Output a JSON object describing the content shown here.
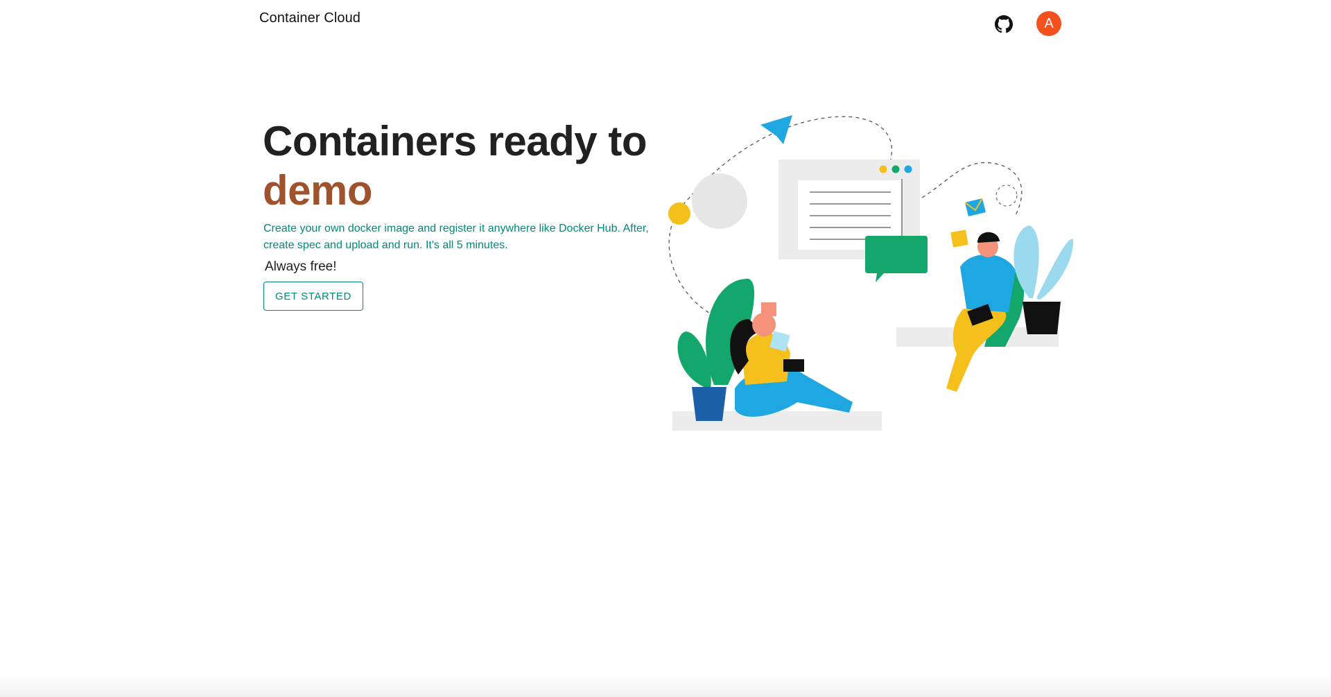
{
  "header": {
    "brand": "Container Cloud",
    "github_icon": "github-icon",
    "avatar_letter": "A"
  },
  "hero": {
    "title_line1": "Containers ready to",
    "title_accent": "demo",
    "description": "Create your own docker image and register it anywhere like Docker Hub. After, create spec and upload and run. It's all 5 minutes.",
    "tagline": "Always free!",
    "cta_label": "GET STARTED"
  },
  "colors": {
    "accent": "#a0522d",
    "teal": "#00897b",
    "avatar": "#f4511e"
  }
}
